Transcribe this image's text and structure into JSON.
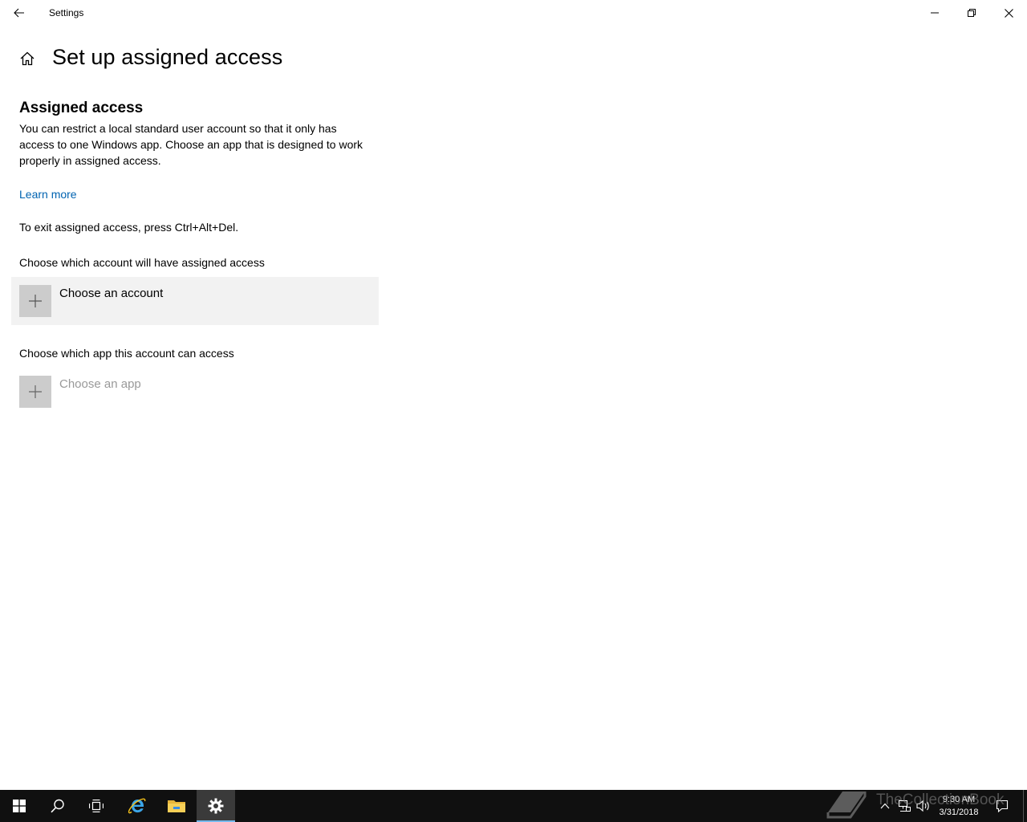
{
  "window": {
    "title": "Settings"
  },
  "header": {
    "page_title": "Set up assigned access"
  },
  "content": {
    "section_title": "Assigned access",
    "description": "You can restrict a local standard user account so that it only has access to one Windows app. Choose an app that is designed to work properly in assigned access.",
    "learn_more": "Learn more",
    "exit_text": "To exit assigned access, press Ctrl+Alt+Del.",
    "account_label": "Choose which account will have assigned access",
    "account_button": "Choose an account",
    "app_label": "Choose which app this account can access",
    "app_button": "Choose an app"
  },
  "taskbar": {
    "time": "9:30 AM",
    "date": "3/31/2018"
  },
  "watermark": {
    "text": "TheCollectionBook"
  },
  "colors": {
    "accent_link": "#0063b1",
    "taskbar": "#101010",
    "row_hover": "#f2f2f2",
    "plus_box": "#cccccc"
  }
}
